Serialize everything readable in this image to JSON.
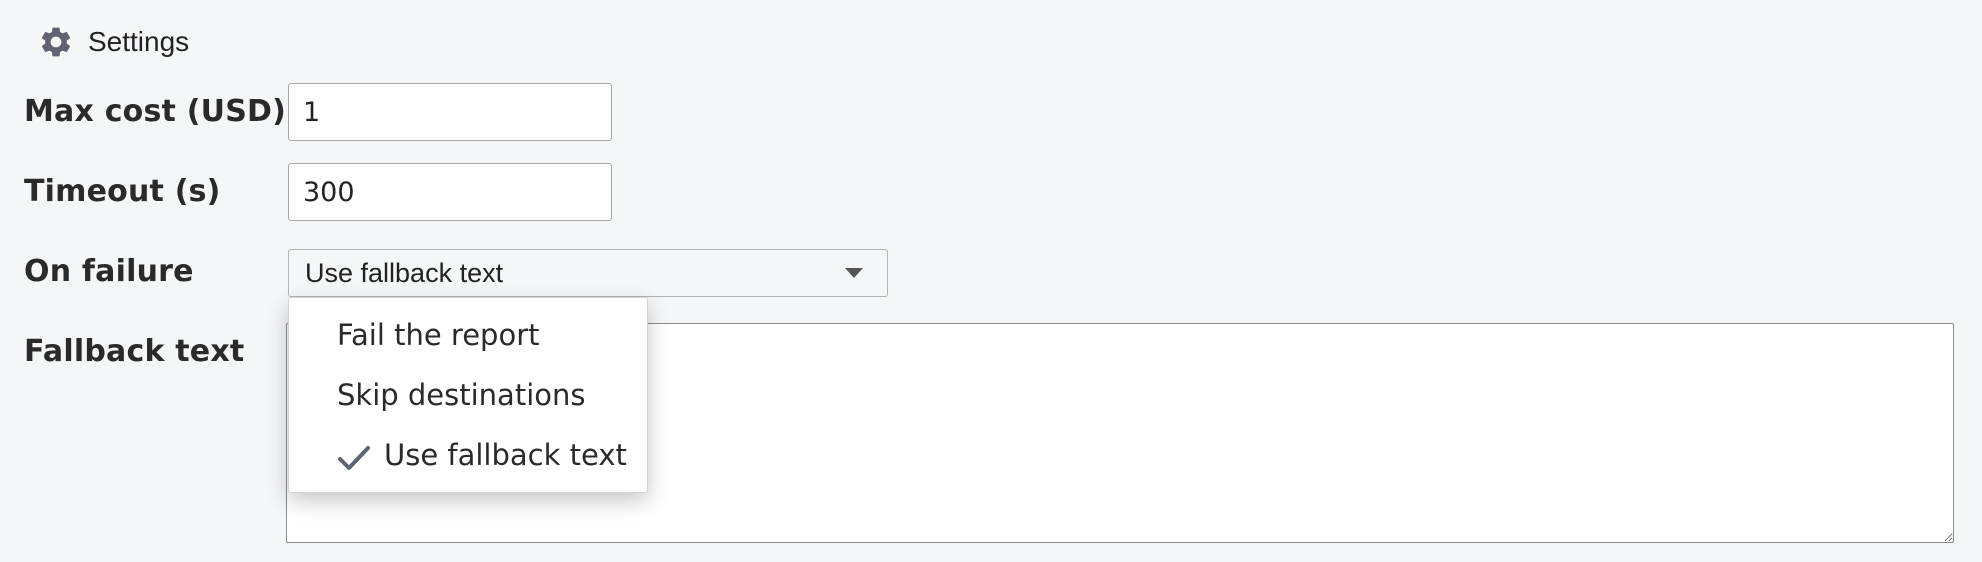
{
  "header": {
    "title": "Settings",
    "icon": "gear-icon"
  },
  "fields": {
    "max_cost": {
      "label": "Max cost (USD)",
      "value": "1"
    },
    "timeout": {
      "label": "Timeout (s)",
      "value": "300"
    },
    "on_failure": {
      "label": "On failure",
      "selected": "Use fallback text",
      "options": [
        "Fail the report",
        "Skip destinations",
        "Use fallback text"
      ],
      "checked_option": "Use fallback text"
    },
    "fallback_text": {
      "label": "Fallback text",
      "value": ""
    }
  },
  "colors": {
    "background": "#f5f6f8",
    "icon": "#5f6470",
    "text": "#222222"
  }
}
